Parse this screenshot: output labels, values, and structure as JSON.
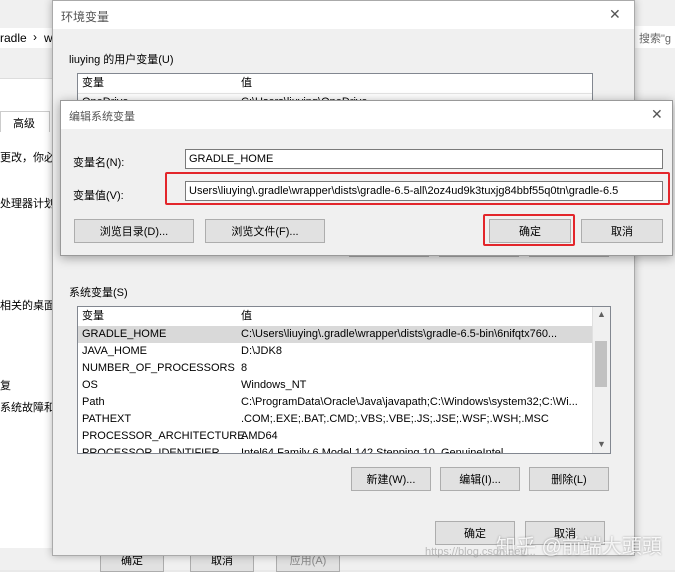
{
  "background": {
    "breadcrumb_text": "radle",
    "breadcrumb_sep": "›",
    "breadcrumb_next": "w",
    "search_placeholder": "搜索\"g",
    "tab_advanced": "高级",
    "side_texts": [
      "更改，你必",
      "处理器计划",
      "相关的桌面",
      "复",
      "系统故障和"
    ],
    "bottom_buttons": [
      "确定",
      "取消",
      "应用(A)"
    ]
  },
  "env_window": {
    "title": "环境变量",
    "user_section_label": "liuying 的用户变量(U)",
    "user_table": {
      "headers": [
        "变量",
        "值"
      ],
      "rows": [
        {
          "name": "OneDrive",
          "value": "C:\\Users\\liuying\\OneDrive"
        }
      ]
    },
    "system_section_label": "系统变量(S)",
    "system_table": {
      "headers": [
        "变量",
        "值"
      ],
      "rows": [
        {
          "name": "GRADLE_HOME",
          "value": "C:\\Users\\liuying\\.gradle\\wrapper\\dists\\gradle-6.5-bin\\6nifqtx760..."
        },
        {
          "name": "JAVA_HOME",
          "value": "D:\\JDK8"
        },
        {
          "name": "NUMBER_OF_PROCESSORS",
          "value": "8"
        },
        {
          "name": "OS",
          "value": "Windows_NT"
        },
        {
          "name": "Path",
          "value": "C:\\ProgramData\\Oracle\\Java\\javapath;C:\\Windows\\system32;C:\\Wi..."
        },
        {
          "name": "PATHEXT",
          "value": ".COM;.EXE;.BAT;.CMD;.VBS;.VBE;.JS;.JSE;.WSF;.WSH;.MSC"
        },
        {
          "name": "PROCESSOR_ARCHITECTURE",
          "value": "AMD64"
        },
        {
          "name": "PROCESSOR_IDENTIFIER",
          "value": "Intel64 Family 6 Model 142 Stepping 10, GenuineIntel"
        }
      ]
    },
    "buttons": {
      "new": "新建(W)...",
      "edit": "编辑(I)...",
      "delete": "删除(L)",
      "ok": "确定",
      "cancel": "取消"
    }
  },
  "edit_dialog": {
    "title": "编辑系统变量",
    "name_label": "变量名(N):",
    "name_value": "GRADLE_HOME",
    "value_label": "变量值(V):",
    "value_value": "Users\\liuying\\.gradle\\wrapper\\dists\\gradle-6.5-all\\2oz4ud9k3tuxjg84bbf55q0tn\\gradle-6.5",
    "browse_dir": "浏览目录(D)...",
    "browse_file": "浏览文件(F)...",
    "ok": "确定",
    "cancel": "取消"
  },
  "watermark": {
    "brand": "知乎 @前端大頭頭",
    "url": "https://blog.csdn.net/..."
  },
  "colors": {
    "highlight": "#e3262b",
    "selected_row": "#d9d9d9"
  }
}
